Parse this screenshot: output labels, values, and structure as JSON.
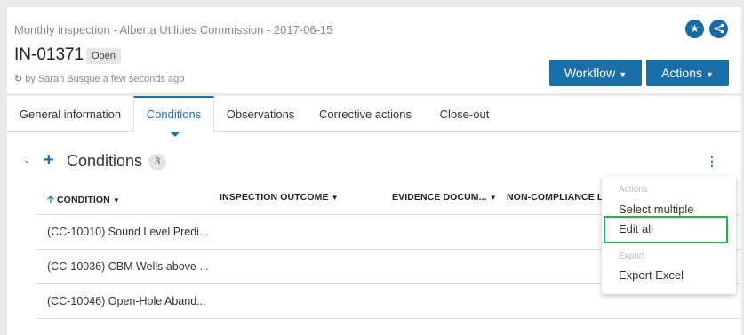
{
  "breadcrumb": "",
  "header": {
    "subtitle": "Monthly inspection - Alberta Utilities Commission - 2017-06-15",
    "record_id": "IN-01371",
    "status": "Open",
    "byline": "by Sarah Busque a few seconds ago",
    "workflow_label": "Workflow",
    "actions_label": "Actions"
  },
  "tabs": [
    {
      "label": "General information"
    },
    {
      "label": "Conditions"
    },
    {
      "label": "Observations"
    },
    {
      "label": "Corrective actions"
    },
    {
      "label": "Close-out"
    }
  ],
  "section": {
    "title": "Conditions",
    "count": "3"
  },
  "table": {
    "columns": [
      {
        "label": "CONDITION"
      },
      {
        "label": "INSPECTION OUTCOME"
      },
      {
        "label": "EVIDENCE DOCUM..."
      },
      {
        "label": "NON-COMPLIANCE L"
      }
    ],
    "rows": [
      {
        "condition": "(CC-10010) Sound Level Predi..."
      },
      {
        "condition": "(CC-10036) CBM Wells above ..."
      },
      {
        "condition": "(CC-10046) Open-Hole Aband..."
      }
    ]
  },
  "menu": {
    "actions_header": "Actions",
    "select_multiple": "Select multiple",
    "edit_all": "Edit all",
    "export_header": "Export",
    "export_excel": "Export Excel"
  },
  "colors": {
    "primary": "#1b6fa8",
    "highlight_border": "#23b34a"
  }
}
